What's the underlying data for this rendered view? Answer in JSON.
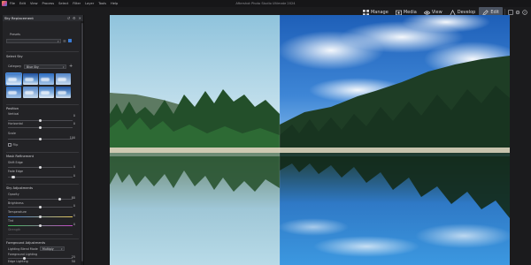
{
  "app": {
    "title": "Aftershot Photo Studio Ultimate 2024",
    "menu": [
      "File",
      "Edit",
      "View",
      "Process",
      "Select",
      "Filter",
      "Layer",
      "Tools",
      "Help"
    ]
  },
  "modes": [
    {
      "icon": "grid-icon",
      "label": "Manage"
    },
    {
      "icon": "media-icon",
      "label": "Media"
    },
    {
      "icon": "eye-icon",
      "label": "View"
    },
    {
      "icon": "develop-icon",
      "label": "Develop"
    },
    {
      "icon": "edit-icon",
      "label": "Edit",
      "active": true
    }
  ],
  "panel": {
    "title": "Sky Replacement",
    "presets_label": "Presets",
    "select_sky": {
      "title": "Select Sky",
      "category_label": "Category",
      "category_value": "Blue Sky"
    },
    "position": {
      "title": "Position",
      "vertical": {
        "label": "Vertical",
        "value": "0"
      },
      "horizontal": {
        "label": "Horizontal",
        "value": "0"
      },
      "scale": {
        "label": "Scale",
        "value": "100"
      },
      "flip": "Flip"
    },
    "mask": {
      "title": "Mask Refinement",
      "shift_edge": {
        "label": "Shift Edge",
        "value": "0"
      },
      "fade_edge": {
        "label": "Fade Edge",
        "value": "0"
      }
    },
    "sky": {
      "title": "Sky Adjustments",
      "opacity": {
        "label": "Opacity",
        "value": "80"
      },
      "brightness": {
        "label": "Brightness",
        "value": "0"
      },
      "temperature": {
        "label": "Temperature",
        "value": "0"
      },
      "tint": {
        "label": "Tint",
        "value": "0"
      },
      "strength": {
        "label": "Strength",
        "value": ""
      }
    },
    "foreground": {
      "title": "Foreground Adjustments",
      "blend_mode_label": "Lighting Blend Mode",
      "blend_mode_value": "Multiply",
      "fg_lighting": {
        "label": "Foreground Lighting",
        "value": "25"
      },
      "edge_lighting": {
        "label": "Edge Lighting",
        "value": "50"
      }
    }
  },
  "colors": {
    "accent": "#4d8fe0",
    "panel_bg": "#232326",
    "app_bg": "#1b1b1d"
  }
}
